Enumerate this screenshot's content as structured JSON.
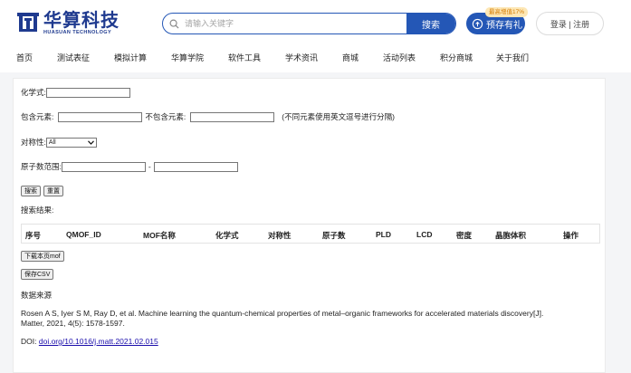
{
  "header": {
    "logo_cn": "华算科技",
    "logo_en": "HUASUAN TECHNOLOGY",
    "search": {
      "placeholder": "请输入关键字",
      "value": "",
      "button": "搜索"
    },
    "promo": {
      "label": "预存有礼",
      "badge": "最高增值17%"
    },
    "login": "登录 | 注册"
  },
  "nav": [
    {
      "label": "首页",
      "icon": ""
    },
    {
      "label": "测试表征"
    },
    {
      "label": "模拟计算"
    },
    {
      "label": "华算学院"
    },
    {
      "label": "软件工具"
    },
    {
      "label": "学术资讯"
    },
    {
      "label": "商城"
    },
    {
      "label": "活动列表"
    },
    {
      "label": "积分商城"
    },
    {
      "label": "关于我们"
    }
  ],
  "form": {
    "formula_label": "化学式:",
    "formula_value": "",
    "include_label": "包含元素:",
    "include_value": "",
    "exclude_label": "不包含元素:",
    "exclude_value": "",
    "element_hint": "(不同元素使用英文逗号进行分隔)",
    "symmetry_label": "对称性:",
    "symmetry_value": "All",
    "atom_range_label": "原子数范围:",
    "atom_min": "",
    "atom_max": "",
    "range_sep": "-",
    "search_btn": "搜索",
    "reset_btn": "重置"
  },
  "results": {
    "label": "搜索结果:",
    "columns": [
      "序号",
      "QMOF_ID",
      "MOF名称",
      "化学式",
      "对称性",
      "原子数",
      "PLD",
      "LCD",
      "密度",
      "晶胞体积",
      "操作"
    ],
    "download_btn": "下载本页mof",
    "save_btn": "保存CSV"
  },
  "source": {
    "title": "数据来源",
    "citation_line1": "Rosen A S, Iyer S M, Ray D, et al. Machine learning the quantum-chemical properties of metal–organic frameworks for accelerated materials discovery[J].",
    "citation_line2": "Matter, 2021, 4(5): 1578-1597.",
    "doi_label": "DOI:",
    "doi_link": "doi.org/10.1016/j.matt.2021.02.015"
  },
  "colors": {
    "brand": "#2457b6",
    "logo": "#1f3a8f",
    "badge_bg": "#fde7b5",
    "badge_fg": "#d47b00"
  }
}
